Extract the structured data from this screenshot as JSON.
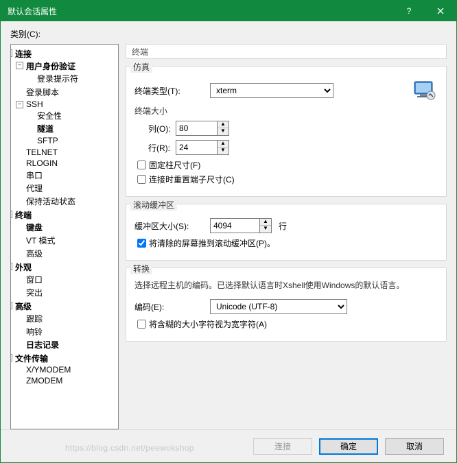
{
  "window": {
    "title": "默认会话属性"
  },
  "labels": {
    "category": "类别(C):"
  },
  "tree": {
    "connection": "连接",
    "auth": "用户身份验证",
    "login_prompt": "登录提示符",
    "login_script": "登录脚本",
    "ssh": "SSH",
    "security": "安全性",
    "tunnel": "隧道",
    "sftp": "SFTP",
    "telnet": "TELNET",
    "rlogin": "RLOGIN",
    "serial": "串口",
    "proxy": "代理",
    "keepalive": "保持活动状态",
    "terminal": "终端",
    "keyboard": "键盘",
    "vtmode": "VT 模式",
    "advanced1": "高级",
    "appearance": "外观",
    "window": "窗口",
    "highlight": "突出",
    "advanced2": "高级",
    "trace": "跟踪",
    "bell": "响铃",
    "logging": "日志记录",
    "filetransfer": "文件传输",
    "xymodem": "X/YMODEM",
    "zmodem": "ZMODEM"
  },
  "panel": {
    "header": "终端",
    "emulation": {
      "legend": "仿真",
      "term_type_label": "终端类型(T):",
      "term_type_value": "xterm",
      "term_size_label": "终端大小",
      "cols_label": "列(O):",
      "cols_value": "80",
      "rows_label": "行(R):",
      "rows_value": "24",
      "fixed_cols": "固定柱尺寸(F)",
      "reset_on_connect": "连接时重置端子尺寸(C)"
    },
    "scrollback": {
      "legend": "滚动缓冲区",
      "buffer_label": "缓冲区大小(S):",
      "buffer_value": "4094",
      "unit": "行",
      "push_cleared": "将清除的屏幕推到滚动缓冲区(P)。"
    },
    "translation": {
      "legend": "转换",
      "note": "选择远程主机的编码。已选择默认语言时Xshell使用Windows的默认语言。",
      "encoding_label": "编码(E):",
      "encoding_value": "Unicode (UTF-8)",
      "ambiguous_wide": "将含糊的大小字符视为宽字符(A)"
    }
  },
  "buttons": {
    "connect": "连接",
    "ok": "确定",
    "cancel": "取消"
  },
  "watermark": "https://blog.csdn.net/peewokshop"
}
